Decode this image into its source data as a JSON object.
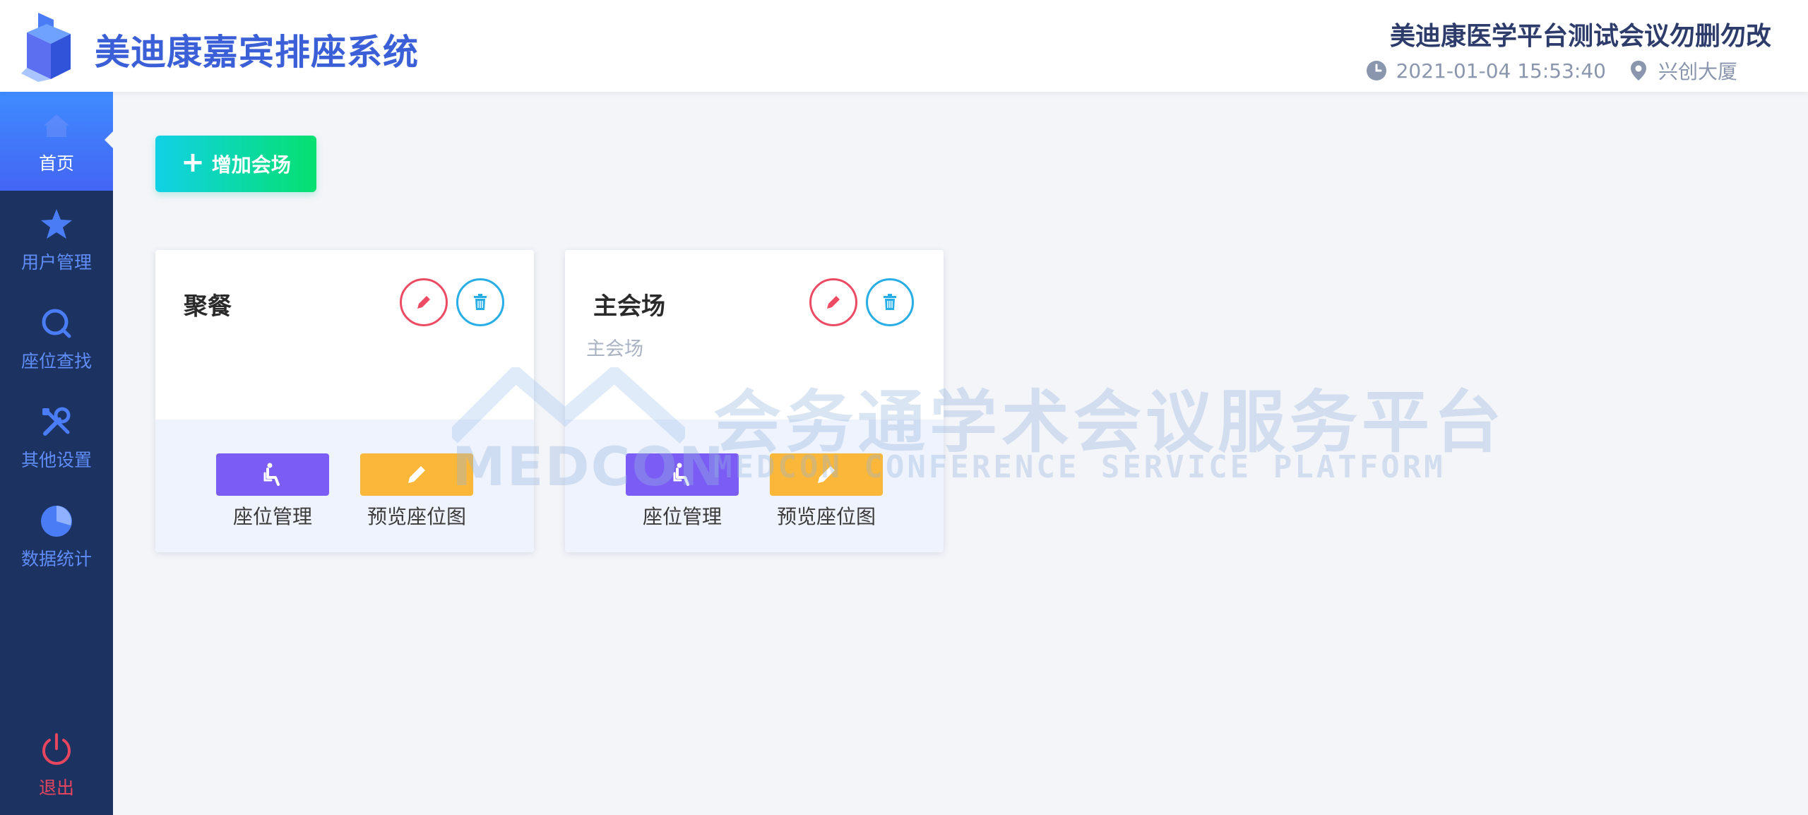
{
  "header": {
    "app_title": "美迪康嘉宾排座系统",
    "meeting_title": "美迪康医学平台测试会议勿删勿改",
    "datetime": "2021-01-04 15:53:40",
    "location": "兴创大厦"
  },
  "sidebar": {
    "items": [
      {
        "label": "首页",
        "icon": "home-icon",
        "active": true
      },
      {
        "label": "用户管理",
        "icon": "star-icon"
      },
      {
        "label": "座位查找",
        "icon": "search-icon"
      },
      {
        "label": "其他设置",
        "icon": "tools-icon"
      },
      {
        "label": "数据统计",
        "icon": "pie-chart-icon"
      }
    ],
    "logout": {
      "label": "退出",
      "icon": "power-icon"
    }
  },
  "main": {
    "add_button": {
      "plus": "+",
      "label": "增加会场"
    },
    "cards": [
      {
        "name": "聚餐",
        "subtitle": "",
        "seat_label": "座位管理",
        "preview_label": "预览座位图"
      },
      {
        "name": "主会场",
        "subtitle": "主会场",
        "seat_label": "座位管理",
        "preview_label": "预览座位图"
      }
    ]
  },
  "watermark": {
    "title": "会务通学术会议服务平台",
    "subtitle": "MEDCON CONFERENCE SERVICE PLATFORM",
    "brand": "MEDCON"
  },
  "colors": {
    "sidebar_bg": "#1c3260",
    "accent_blue": "#4465f4",
    "edit_red": "#ec4b63",
    "delete_blue": "#28aee6",
    "seat_purple": "#7b5cf5",
    "preview_yellow": "#fab73a"
  }
}
